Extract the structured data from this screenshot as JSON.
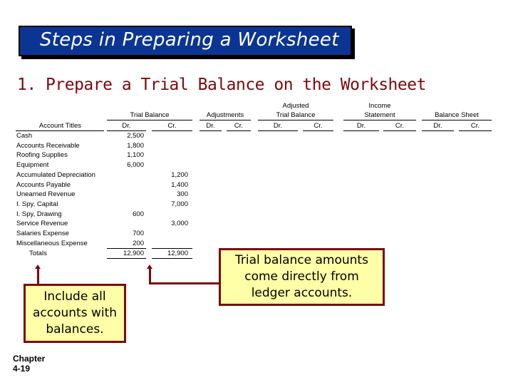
{
  "slide": {
    "title": "Steps in Preparing a Worksheet",
    "subtitle": "1. Prepare a Trial Balance on the Worksheet",
    "colors": {
      "title_bg": "#0c3593",
      "accent": "#7a0a0f",
      "note_bg": "#ffffa8"
    }
  },
  "worksheet": {
    "account_titles_header": "Account Titles",
    "column_groups": [
      {
        "label_line1": "",
        "label_line2": "Trial Balance",
        "dr": "Dr.",
        "cr": "Cr."
      },
      {
        "label_line1": "",
        "label_line2": "Adjustments",
        "dr": "Dr.",
        "cr": "Cr."
      },
      {
        "label_line1": "Adjusted",
        "label_line2": "Trial Balance",
        "dr": "Dr.",
        "cr": "Cr."
      },
      {
        "label_line1": "Income",
        "label_line2": "Statement",
        "dr": "Dr.",
        "cr": "Cr."
      },
      {
        "label_line1": "",
        "label_line2": "Balance Sheet",
        "dr": "Dr.",
        "cr": "Cr."
      }
    ],
    "rows": [
      {
        "account": "Cash",
        "dr": "2,500",
        "cr": ""
      },
      {
        "account": "Accounts Receivable",
        "dr": "1,800",
        "cr": ""
      },
      {
        "account": "Roofing Supplies",
        "dr": "1,100",
        "cr": ""
      },
      {
        "account": "Equipment",
        "dr": "6,000",
        "cr": ""
      },
      {
        "account": "Accumulated Depreciation",
        "dr": "",
        "cr": "1,200"
      },
      {
        "account": "Accounts Payable",
        "dr": "",
        "cr": "1,400"
      },
      {
        "account": "Unearned Revenue",
        "dr": "",
        "cr": "300"
      },
      {
        "account": "I. Spy, Capital",
        "dr": "",
        "cr": "7,000"
      },
      {
        "account": "I. Spy, Drawing",
        "dr": "600",
        "cr": ""
      },
      {
        "account": "Service Revenue",
        "dr": "",
        "cr": "3,000"
      },
      {
        "account": "Salaries Expense",
        "dr": "700",
        "cr": ""
      },
      {
        "account": "Miscellaneous Expense",
        "dr": "200",
        "cr": ""
      }
    ],
    "totals": {
      "label": "Totals",
      "dr": "12,900",
      "cr": "12,900"
    }
  },
  "notes": {
    "left": "Include all accounts with balances.",
    "right": "Trial balance amounts come directly from ledger accounts."
  },
  "footer": {
    "line1": "Chapter",
    "line2": "4-19"
  }
}
